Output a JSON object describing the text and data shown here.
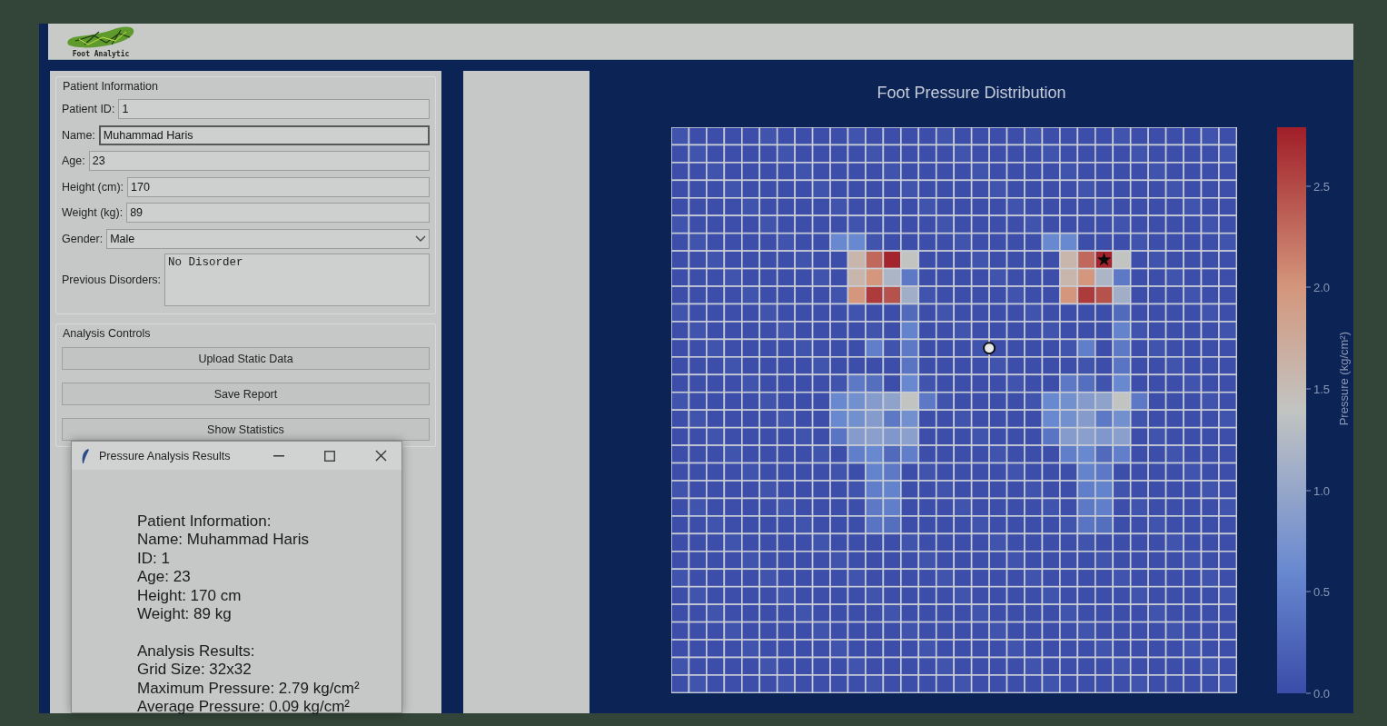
{
  "app": {
    "logo_text": "Foot Analytic"
  },
  "patient_info": {
    "title": "Patient Information",
    "fields": [
      {
        "kind": "text",
        "label": "Patient ID:",
        "value": "1",
        "focused": false
      },
      {
        "kind": "text",
        "label": "Name:",
        "value": "Muhammad Haris",
        "focused": true
      },
      {
        "kind": "text",
        "label": "Age:",
        "value": "23",
        "focused": false
      },
      {
        "kind": "text",
        "label": "Height (cm):",
        "value": "170",
        "focused": false
      },
      {
        "kind": "text",
        "label": "Weight (kg):",
        "value": "89",
        "focused": false
      },
      {
        "kind": "select",
        "label": "Gender:",
        "value": "Male",
        "focused": false
      },
      {
        "kind": "textarea",
        "label": "Previous Disorders:",
        "value": "No Disorder",
        "focused": false
      }
    ]
  },
  "analysis_controls": {
    "title": "Analysis Controls",
    "buttons": [
      "Upload Static Data",
      "Save Report",
      "Show Statistics"
    ]
  },
  "results_window": {
    "title": "Pressure Analysis Results",
    "sections": [
      {
        "heading": "Patient Information:",
        "lines": [
          "Name: Muhammad Haris",
          "ID: 1",
          "Age: 23",
          "Height: 170 cm",
          "Weight: 89 kg"
        ]
      },
      {
        "heading": "Analysis Results:",
        "lines": [
          "Grid Size: 32x32",
          "Maximum Pressure: 2.79 kg/cm²",
          "Average Pressure: 0.09 kg/cm²"
        ]
      }
    ]
  },
  "plot": {
    "title": "Foot Pressure Distribution",
    "colorbar": {
      "label": "Pressure (kg/cm²)",
      "ticks": [
        "2.5",
        "2.0",
        "1.5",
        "1.0",
        "0.5",
        "0.0"
      ]
    }
  }
}
